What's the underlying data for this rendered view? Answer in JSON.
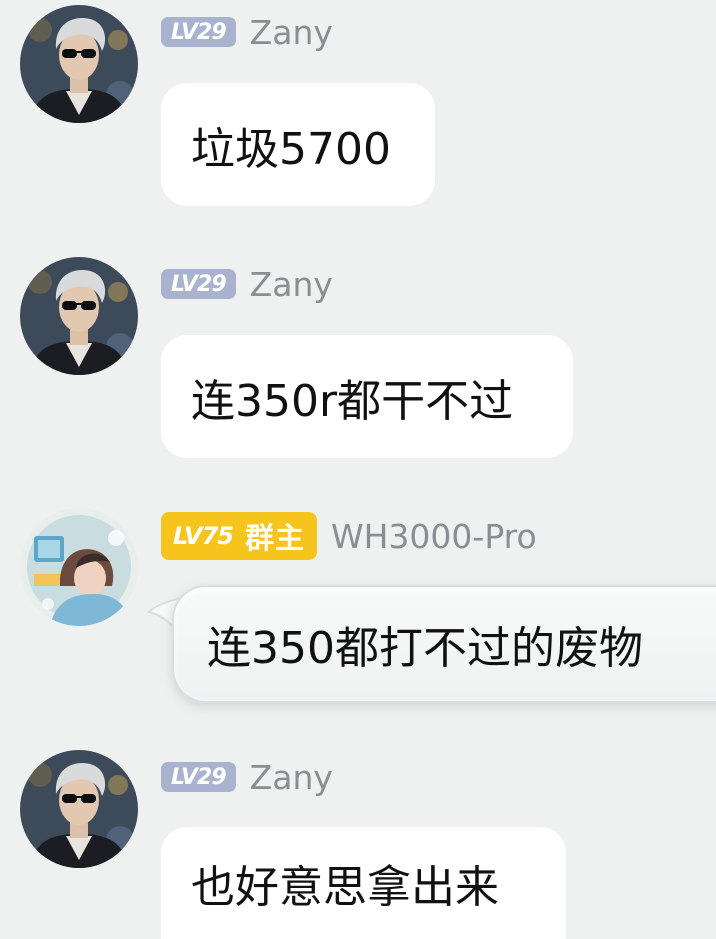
{
  "chat": {
    "messages": [
      {
        "level": "LV29",
        "sender": "Zany",
        "text": "垃圾5700"
      },
      {
        "level": "LV29",
        "sender": "Zany",
        "text": "连350r都干不过"
      },
      {
        "level": "LV75",
        "role": "群主",
        "sender": "WH3000-Pro",
        "text": "连350都打不过的废物"
      },
      {
        "level": "LV29",
        "sender": "Zany",
        "text": "也好意思拿出来"
      }
    ]
  },
  "colors": {
    "background": "#eef1ef",
    "level_badge_default": "#a9b3cf",
    "level_badge_owner": "#f6c51d",
    "sender_name": "#8a8e93",
    "bubble": "#ffffff"
  },
  "icons": {
    "zany_avatar": "avatar-man-sunglasses",
    "owner_avatar": "avatar-anime-illustration"
  }
}
